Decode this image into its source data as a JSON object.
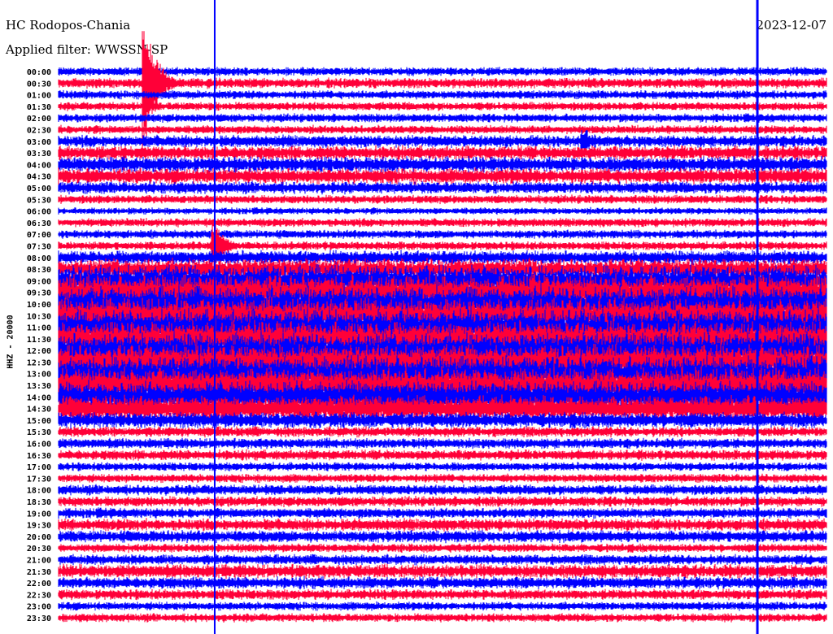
{
  "header": {
    "station": "HC Rodopos-Chania",
    "filter": "Applied filter: WWSSN-SP",
    "date": "2023-12-07"
  },
  "channel_label": "HHZ - 20000",
  "chart_data": {
    "type": "helicorder",
    "title": "HC Rodopos-Chania",
    "row_minutes": 30,
    "row_labels": [
      "00:00",
      "00:30",
      "01:00",
      "01:30",
      "02:00",
      "02:30",
      "03:00",
      "03:30",
      "04:00",
      "04:30",
      "05:00",
      "05:30",
      "06:00",
      "06:30",
      "07:00",
      "07:30",
      "08:00",
      "08:30",
      "09:00",
      "09:30",
      "10:00",
      "10:30",
      "11:00",
      "11:30",
      "12:00",
      "12:30",
      "13:00",
      "13:30",
      "14:00",
      "14:30",
      "15:00",
      "15:30",
      "16:00",
      "16:30",
      "17:00",
      "17:30",
      "18:00",
      "18:30",
      "19:00",
      "19:30",
      "20:00",
      "20:30",
      "21:00",
      "21:30",
      "22:00",
      "22:30",
      "23:00",
      "23:30"
    ],
    "relative_amplitude": [
      5,
      6,
      5,
      5,
      5,
      5,
      7,
      8,
      9,
      9,
      7,
      5,
      4,
      5,
      5,
      5,
      8,
      12,
      18,
      20,
      20,
      20,
      20,
      20,
      20,
      20,
      20,
      20,
      18,
      15,
      9,
      6,
      6,
      6,
      5,
      5,
      6,
      6,
      6,
      7,
      7,
      5,
      6,
      8,
      7,
      6,
      5,
      5
    ],
    "series_colors": [
      "#0000ff",
      "#ff0038"
    ],
    "events": [
      {
        "row": "00:30",
        "minute": 3.4,
        "peak": 95
      },
      {
        "row": "03:00",
        "minute": 20.5,
        "peak": 20
      },
      {
        "row": "07:30",
        "minute": 6.1,
        "peak": 35
      },
      {
        "row": "09:30",
        "minute": 27.3,
        "peak": 30
      }
    ],
    "marker_minutes": [
      6.1,
      27.3
    ],
    "marker_color": "#0000ff"
  }
}
